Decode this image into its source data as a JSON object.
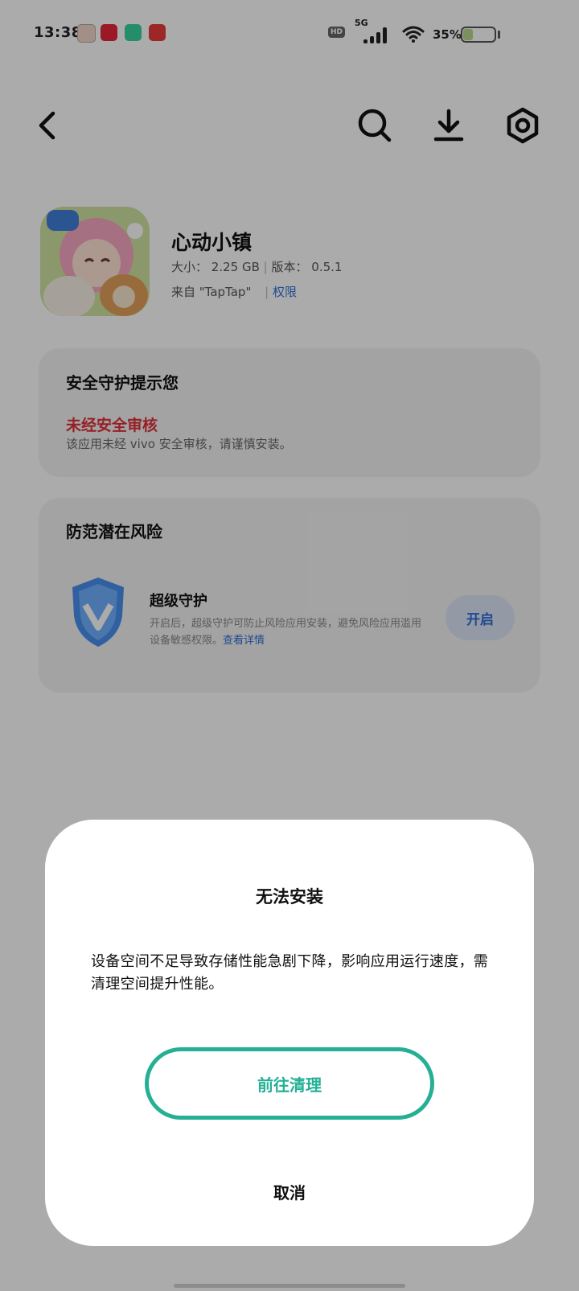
{
  "status_bar": {
    "time": "13:38",
    "hd": "HD",
    "network": "5G",
    "battery_pct": "35%",
    "battery_level": 0.35
  },
  "top_bar": {
    "icons": [
      "back-icon",
      "search-icon",
      "download-icon",
      "settings-icon"
    ]
  },
  "app": {
    "name": "心动小镇",
    "size_label": "大小：",
    "size_value": "2.25 GB",
    "version_label": "版本：",
    "version_value": "0.5.1",
    "source": "来自 \"TapTap\"",
    "permissions": "权限"
  },
  "security_card": {
    "title": "安全守护提示您",
    "warning_title": "未经安全审核",
    "warning_text": "该应用未经 vivo 安全审核，请谨慎安装。"
  },
  "risk_card": {
    "title": "防范潜在风险",
    "feature_title": "超级守护",
    "feature_desc": "开启后，超级守护可防止风险应用安装，避免风险应用滥用设备敏感权限。",
    "details_link": "查看详情",
    "enable_button": "开启"
  },
  "dialog": {
    "title": "无法安装",
    "message": "设备空间不足导致存储性能急剧下降，影响应用运行速度，需清理空间提升性能。",
    "primary_button": "前往清理",
    "cancel_button": "取消"
  },
  "colors": {
    "accent_green": "#25b095",
    "link_blue": "#2f6fd6",
    "warning_red": "#e0303a"
  }
}
